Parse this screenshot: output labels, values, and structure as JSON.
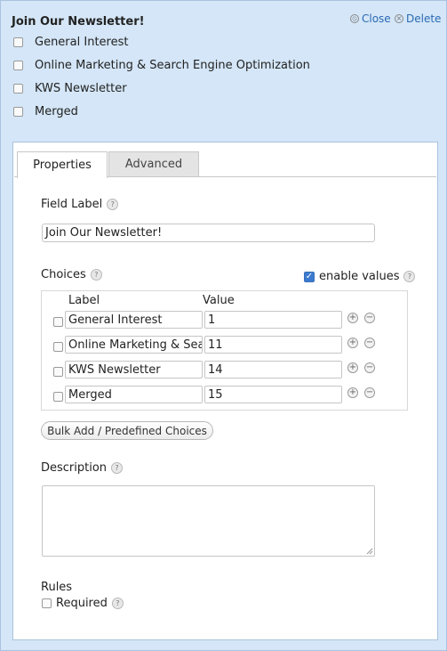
{
  "field_title": "Join Our Newsletter!",
  "actions": {
    "close_label": "Close",
    "delete_label": "Delete"
  },
  "preview_options": [
    "General Interest",
    "Online Marketing & Search Engine Optimization",
    "KWS Newsletter",
    "Merged"
  ],
  "tabs": [
    {
      "label": "Properties",
      "active": true
    },
    {
      "label": "Advanced",
      "active": false
    }
  ],
  "properties": {
    "field_label_title": "Field Label",
    "field_label_value": "Join Our Newsletter!",
    "choices_title": "Choices",
    "enable_values_label": "enable values",
    "enable_values_checked": true,
    "columns": {
      "label": "Label",
      "value": "Value"
    },
    "choices": [
      {
        "label": "General Interest",
        "value": "1",
        "checked": false
      },
      {
        "label": "Online Marketing & Search Engine Optimization",
        "value": "11",
        "checked": false
      },
      {
        "label": "KWS Newsletter",
        "value": "14",
        "checked": false
      },
      {
        "label": "Merged",
        "value": "15",
        "checked": false
      }
    ],
    "bulk_add_label": "Bulk Add / Predefined Choices",
    "description_title": "Description",
    "description_value": "",
    "rules_title": "Rules",
    "required_label": "Required",
    "required_checked": false
  },
  "colors": {
    "link": "#2a6ab5",
    "panel_bg": "#d4e6f7",
    "checkbox_accent": "#3a7ad0"
  }
}
